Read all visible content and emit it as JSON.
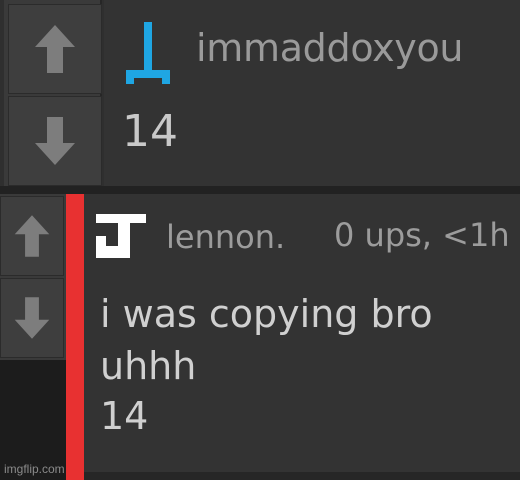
{
  "comments": [
    {
      "username": "immaddoxyou",
      "count": "14",
      "avatar_icon": "blue-glyph-icon",
      "avatar_color": "#1fa6e3"
    },
    {
      "username": "lennon.",
      "meta": "0 ups, <1h",
      "text_line1": "i was copying bro",
      "text_line2": "uhhh",
      "count": "14",
      "avatar_icon": "j-logo-icon",
      "accent_color": "#e83131"
    }
  ],
  "watermark": "imgflip.com"
}
